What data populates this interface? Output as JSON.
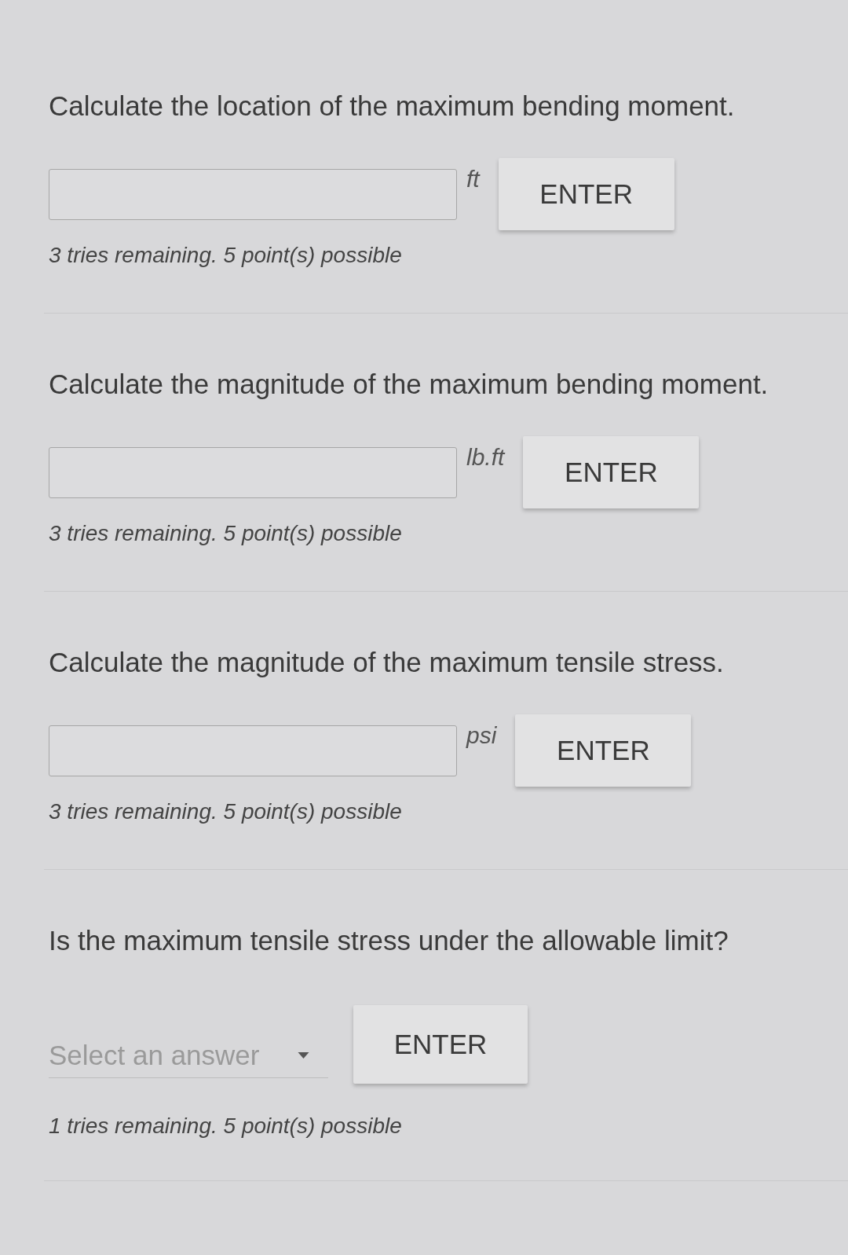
{
  "questions": [
    {
      "kind": "numeric",
      "prompt": "Calculate the location of the maximum bending moment.",
      "unit": "ft",
      "button": "ENTER",
      "status": "3 tries remaining. 5 point(s) possible"
    },
    {
      "kind": "numeric",
      "prompt": "Calculate the magnitude of the maximum bending moment.",
      "unit": "lb.ft",
      "button": "ENTER",
      "status": "3 tries remaining. 5 point(s) possible"
    },
    {
      "kind": "numeric",
      "prompt": "Calculate the magnitude of the maximum tensile stress.",
      "unit": "psi",
      "button": "ENTER",
      "status": "3 tries remaining. 5 point(s) possible"
    },
    {
      "kind": "select",
      "prompt": "Is the maximum tensile stress under the allowable limit?",
      "select": {
        "placeholder": "Select an answer"
      },
      "button": "ENTER",
      "status": "1 tries remaining. 5 point(s) possible"
    }
  ]
}
